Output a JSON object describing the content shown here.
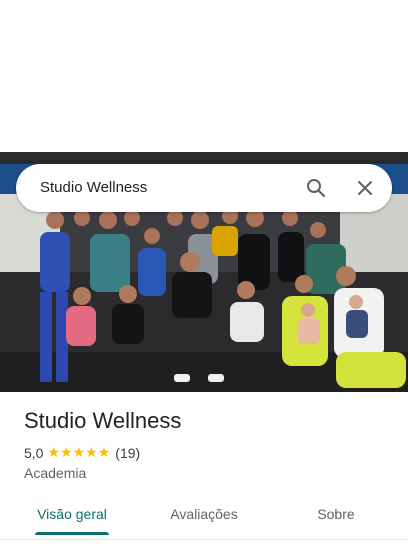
{
  "search": {
    "query": "Studio Wellness"
  },
  "place": {
    "name": "Studio Wellness",
    "rating": "5,0",
    "stars": 5,
    "review_count": "(19)",
    "category": "Academia"
  },
  "tabs": [
    {
      "label": "Visão geral",
      "active": true
    },
    {
      "label": "Avaliações",
      "active": false
    },
    {
      "label": "Sobre",
      "active": false
    }
  ],
  "colors": {
    "accent": "#0b6e6b",
    "star": "#fbbc04"
  }
}
